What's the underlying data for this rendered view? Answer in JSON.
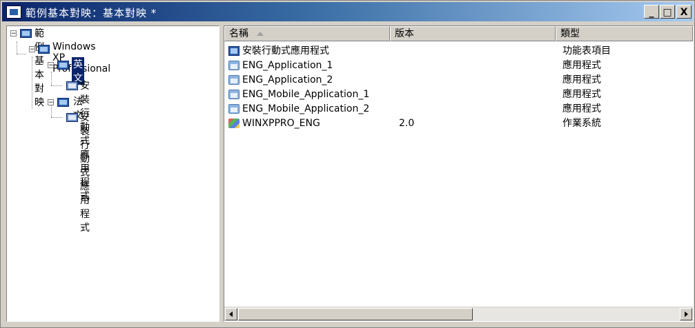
{
  "window": {
    "title": "範例基本對映：基本對映 *",
    "buttons": {
      "minimize": "_",
      "maximize": "□",
      "close": "X"
    }
  },
  "tree": {
    "root": {
      "label": "範例基本對映"
    },
    "os": {
      "label": "Windows XP Professional"
    },
    "lang1": {
      "label": "英文",
      "selected": true
    },
    "lang1_child": {
      "label": "安裝行動式應用程式"
    },
    "lang2": {
      "label": "法文"
    },
    "lang2_child": {
      "label": "安裝行動式應用程式"
    }
  },
  "list": {
    "columns": [
      {
        "label": "名稱"
      },
      {
        "label": "版本"
      },
      {
        "label": "類型"
      }
    ],
    "rows": [
      {
        "name": "安裝行動式應用程式",
        "version": "",
        "type": "功能表項目",
        "icon": "menu-icon"
      },
      {
        "name": "ENG_Application_1",
        "version": "",
        "type": "應用程式",
        "icon": "application-icon"
      },
      {
        "name": "ENG_Application_2",
        "version": "",
        "type": "應用程式",
        "icon": "application-icon"
      },
      {
        "name": "ENG_Mobile_Application_1",
        "version": "",
        "type": "應用程式",
        "icon": "application-icon"
      },
      {
        "name": "ENG_Mobile_Application_2",
        "version": "",
        "type": "應用程式",
        "icon": "application-icon"
      },
      {
        "name": "WINXPPRO_ENG",
        "version": "2.0",
        "type": "作業系統",
        "icon": "windows-os-icon"
      }
    ]
  },
  "colors": {
    "selection": "#0a246a",
    "title_start": "#0a246a",
    "title_end": "#a6caf0"
  }
}
